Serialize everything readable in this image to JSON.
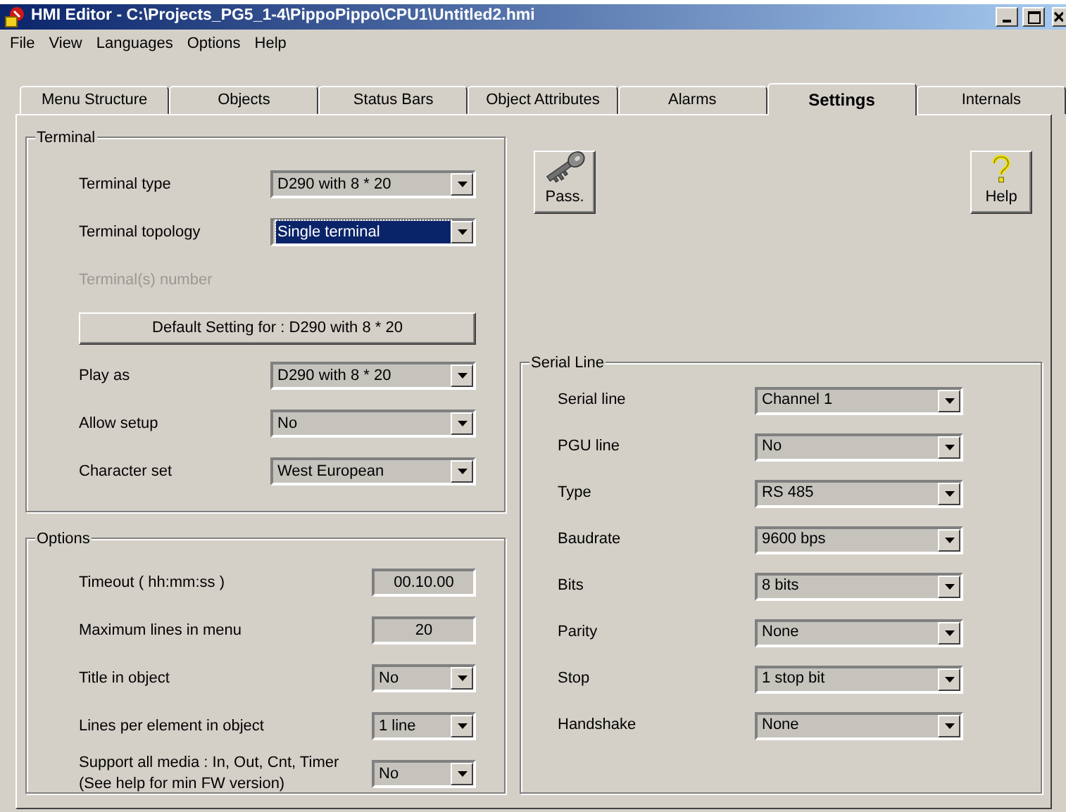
{
  "window": {
    "title": "HMI Editor - C:\\Projects_PG5_1-4\\PippoPippo\\CPU1\\Untitled2.hmi"
  },
  "menu": [
    "File",
    "View",
    "Languages",
    "Options",
    "Help"
  ],
  "tabs": [
    {
      "label": "Menu Structure",
      "selected": false
    },
    {
      "label": "Objects",
      "selected": false
    },
    {
      "label": "Status Bars",
      "selected": false
    },
    {
      "label": "Object Attributes",
      "selected": false
    },
    {
      "label": "Alarms",
      "selected": false
    },
    {
      "label": "Settings",
      "selected": true
    },
    {
      "label": "Internals",
      "selected": false
    }
  ],
  "terminal": {
    "title": "Terminal",
    "rows": [
      {
        "kind": "select",
        "label": "Terminal type",
        "value": "D290 with 8 * 20",
        "focused": false
      },
      {
        "kind": "select",
        "label": "Terminal topology",
        "value": "Single terminal",
        "focused": true
      },
      {
        "kind": "label",
        "label": "Terminal(s) number",
        "disabled": true
      },
      {
        "kind": "button",
        "label": "Default Setting for : D290 with 8 * 20"
      },
      {
        "kind": "select",
        "label": "Play as",
        "value": "D290 with 8 * 20",
        "focused": false
      },
      {
        "kind": "select",
        "label": "Allow setup",
        "value": "No",
        "focused": false
      },
      {
        "kind": "select",
        "label": "Character set",
        "value": "West European",
        "focused": false
      }
    ]
  },
  "options": {
    "title": "Options",
    "rows": [
      {
        "kind": "text",
        "label": "Timeout  ( hh:mm:ss )",
        "value": "00.10.00"
      },
      {
        "kind": "text",
        "label": "Maximum lines in menu",
        "value": "20"
      },
      {
        "kind": "select",
        "label": "Title in object",
        "value": "No",
        "focused": false
      },
      {
        "kind": "select",
        "label": "Lines per element in object",
        "value": "1 line",
        "focused": false
      },
      {
        "kind": "select",
        "label": "Support all media : In, Out, Cnt, Timer",
        "note": "(See help for min FW version)",
        "value": "No",
        "focused": false
      }
    ]
  },
  "toolbar": [
    {
      "kind": "key",
      "label": "Pass."
    },
    {
      "kind": "help",
      "label": "Help"
    }
  ],
  "serial_line": {
    "title": "Serial Line",
    "rows": [
      {
        "kind": "select",
        "label": "Serial line",
        "value": "Channel 1",
        "focused": false
      },
      {
        "kind": "select",
        "label": "PGU line",
        "value": "No",
        "focused": false
      },
      {
        "kind": "select",
        "label": "Type",
        "value": "RS 485",
        "focused": false
      },
      {
        "kind": "select",
        "label": "Baudrate",
        "value": "9600 bps",
        "focused": false
      },
      {
        "kind": "select",
        "label": "Bits",
        "value": "8 bits",
        "focused": false
      },
      {
        "kind": "select",
        "label": "Parity",
        "value": "None",
        "focused": false
      },
      {
        "kind": "select",
        "label": "Stop",
        "value": "1 stop bit",
        "focused": false
      },
      {
        "kind": "select",
        "label": "Handshake",
        "value": "None",
        "focused": false
      }
    ]
  }
}
